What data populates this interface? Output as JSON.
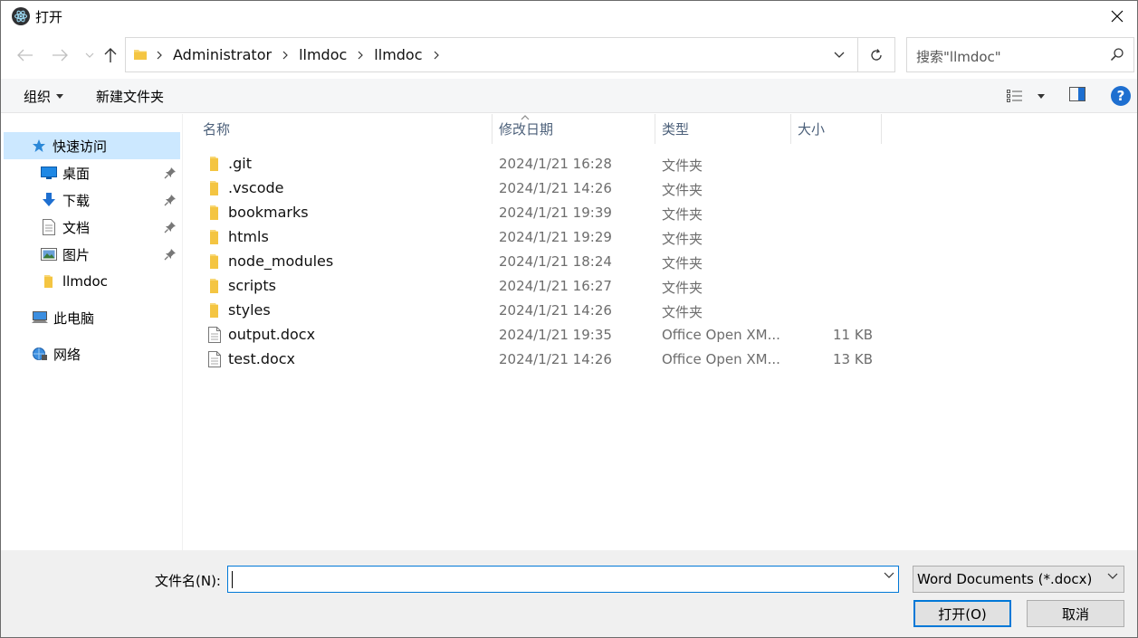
{
  "window": {
    "title": "打开",
    "close_glyph": "✕"
  },
  "address": {
    "crumbs": [
      "Administrator",
      "llmdoc",
      "llmdoc"
    ]
  },
  "search": {
    "placeholder": "搜索\"llmdoc\""
  },
  "toolbar": {
    "organize_label": "组织",
    "new_folder_label": "新建文件夹",
    "help_glyph": "?"
  },
  "nav": {
    "items": [
      {
        "label": "快速访问",
        "icon": "star-icon",
        "pinned": false
      },
      {
        "label": "桌面",
        "icon": "desktop-icon",
        "pinned": true
      },
      {
        "label": "下载",
        "icon": "download-icon",
        "pinned": true
      },
      {
        "label": "文档",
        "icon": "document-icon",
        "pinned": true
      },
      {
        "label": "图片",
        "icon": "picture-icon",
        "pinned": true
      },
      {
        "label": "llmdoc",
        "icon": "folder-icon",
        "pinned": false
      },
      {
        "label": "此电脑",
        "icon": "computer-icon",
        "pinned": false
      },
      {
        "label": "网络",
        "icon": "network-icon",
        "pinned": false
      }
    ]
  },
  "columns": {
    "name": "名称",
    "date": "修改日期",
    "type": "类型",
    "size": "大小"
  },
  "files": [
    {
      "name": ".git",
      "date": "2024/1/21 16:28",
      "type": "文件夹",
      "size": "",
      "kind": "folder"
    },
    {
      "name": ".vscode",
      "date": "2024/1/21 14:26",
      "type": "文件夹",
      "size": "",
      "kind": "folder"
    },
    {
      "name": "bookmarks",
      "date": "2024/1/21 19:39",
      "type": "文件夹",
      "size": "",
      "kind": "folder"
    },
    {
      "name": "htmls",
      "date": "2024/1/21 19:29",
      "type": "文件夹",
      "size": "",
      "kind": "folder"
    },
    {
      "name": "node_modules",
      "date": "2024/1/21 18:24",
      "type": "文件夹",
      "size": "",
      "kind": "folder"
    },
    {
      "name": "scripts",
      "date": "2024/1/21 16:27",
      "type": "文件夹",
      "size": "",
      "kind": "folder"
    },
    {
      "name": "styles",
      "date": "2024/1/21 14:26",
      "type": "文件夹",
      "size": "",
      "kind": "folder"
    },
    {
      "name": "output.docx",
      "date": "2024/1/21 19:35",
      "type": "Office Open XM...",
      "size": "11 KB",
      "kind": "file"
    },
    {
      "name": "test.docx",
      "date": "2024/1/21 14:26",
      "type": "Office Open XM...",
      "size": "13 KB",
      "kind": "file"
    }
  ],
  "bottom": {
    "filename_label": "文件名(N):",
    "filename_value": "",
    "filetype_value": "Word Documents (*.docx)",
    "open_label": "打开(O)",
    "cancel_label": "取消"
  },
  "colors": {
    "accent": "#0078d7",
    "selected_bg": "#cce8ff",
    "folder_yellow": "#f8d775",
    "help_blue": "#1e6fd0"
  }
}
